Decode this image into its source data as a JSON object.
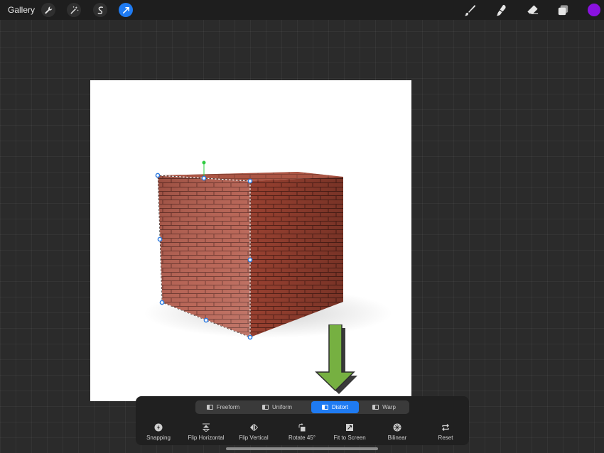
{
  "topbar": {
    "gallery_label": "Gallery",
    "left_tools": [
      {
        "icon": "wrench-icon",
        "name": "actions"
      },
      {
        "icon": "magic-wand-icon",
        "name": "adjustments"
      },
      {
        "icon": "selection-icon",
        "name": "selection"
      },
      {
        "icon": "transform-arrow-icon",
        "name": "transform",
        "active": true
      }
    ],
    "right_tools": [
      {
        "icon": "brush-icon",
        "name": "paint"
      },
      {
        "icon": "smudge-icon",
        "name": "smudge"
      },
      {
        "icon": "eraser-icon",
        "name": "erase"
      },
      {
        "icon": "layers-icon",
        "name": "layers"
      }
    ],
    "current_color": "#8a12e0",
    "active_accent": "#1f7bf2"
  },
  "transform_panel": {
    "modes": [
      {
        "label": "Freeform",
        "active": false
      },
      {
        "label": "Uniform",
        "active": false
      },
      {
        "label": "Distort",
        "active": true
      },
      {
        "label": "Warp",
        "active": false
      }
    ],
    "actions": [
      {
        "label": "Snapping",
        "icon": "snapping-icon"
      },
      {
        "label": "Flip Horizontal",
        "icon": "flip-horizontal-icon"
      },
      {
        "label": "Flip Vertical",
        "icon": "flip-vertical-icon"
      },
      {
        "label": "Rotate 45°",
        "icon": "rotate-icon"
      },
      {
        "label": "Fit to Screen",
        "icon": "fit-to-screen-icon"
      },
      {
        "label": "Bilinear",
        "icon": "bilinear-icon"
      },
      {
        "label": "Reset",
        "icon": "reset-icon"
      }
    ]
  },
  "canvas": {
    "background": "#ffffff",
    "subject": "brick cube",
    "annotation_arrow_color": "#76b041"
  }
}
